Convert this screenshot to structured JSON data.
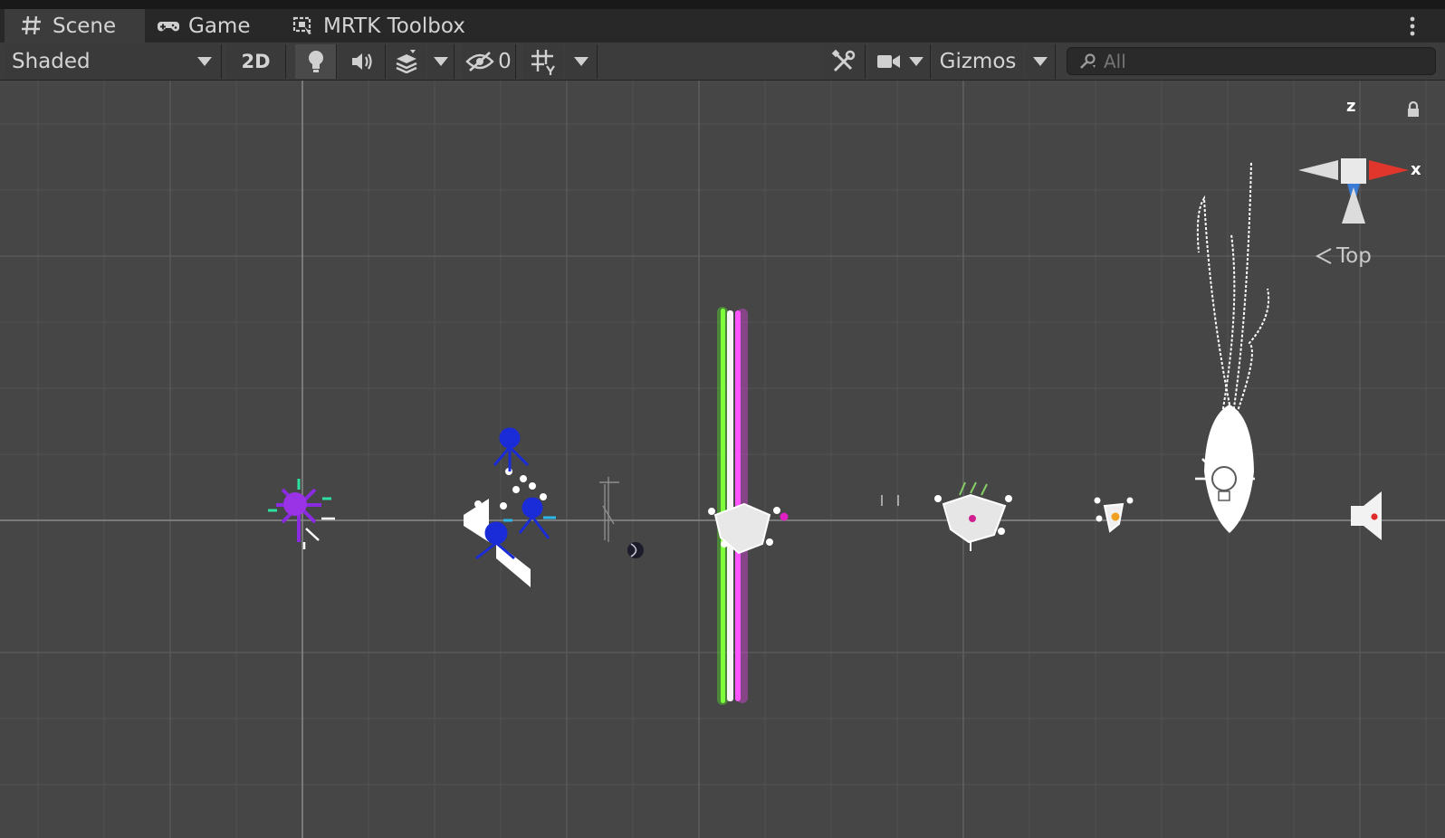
{
  "tabs": [
    {
      "label": "Scene",
      "icon": "scene-grid-icon",
      "active": true
    },
    {
      "label": "Game",
      "icon": "gamepad-icon",
      "active": false
    },
    {
      "label": "MRTK Toolbox",
      "icon": "toolbox-icon",
      "active": false
    }
  ],
  "toolbar": {
    "shading_mode": "Shaded",
    "mode_2d": "2D",
    "hidden_count": "0",
    "gizmos": "Gizmos",
    "search_placeholder": "All"
  },
  "gizmo": {
    "view_label": "Top",
    "axis_x": "x",
    "axis_z": "z"
  },
  "colors": {
    "viewport_bg": "#464646",
    "toolbar_bg": "#3c3c3c",
    "tabbar_bg": "#282828",
    "axis_x": "#e0362b",
    "axis_z": "#3a7bd5",
    "green_beam": "#55ff22",
    "magenta_beam": "#ff44ff"
  },
  "scene_objects": [
    "purple-particle-emitter",
    "blue-reflection-probes-cluster",
    "audio-source-icon",
    "wireframe-figure",
    "small-sphere",
    "green-magenta-beam",
    "particle-cluster",
    "small-particle-cluster",
    "wispy-particle-trail",
    "light-bulb-icon",
    "audio-source-icon-right"
  ]
}
